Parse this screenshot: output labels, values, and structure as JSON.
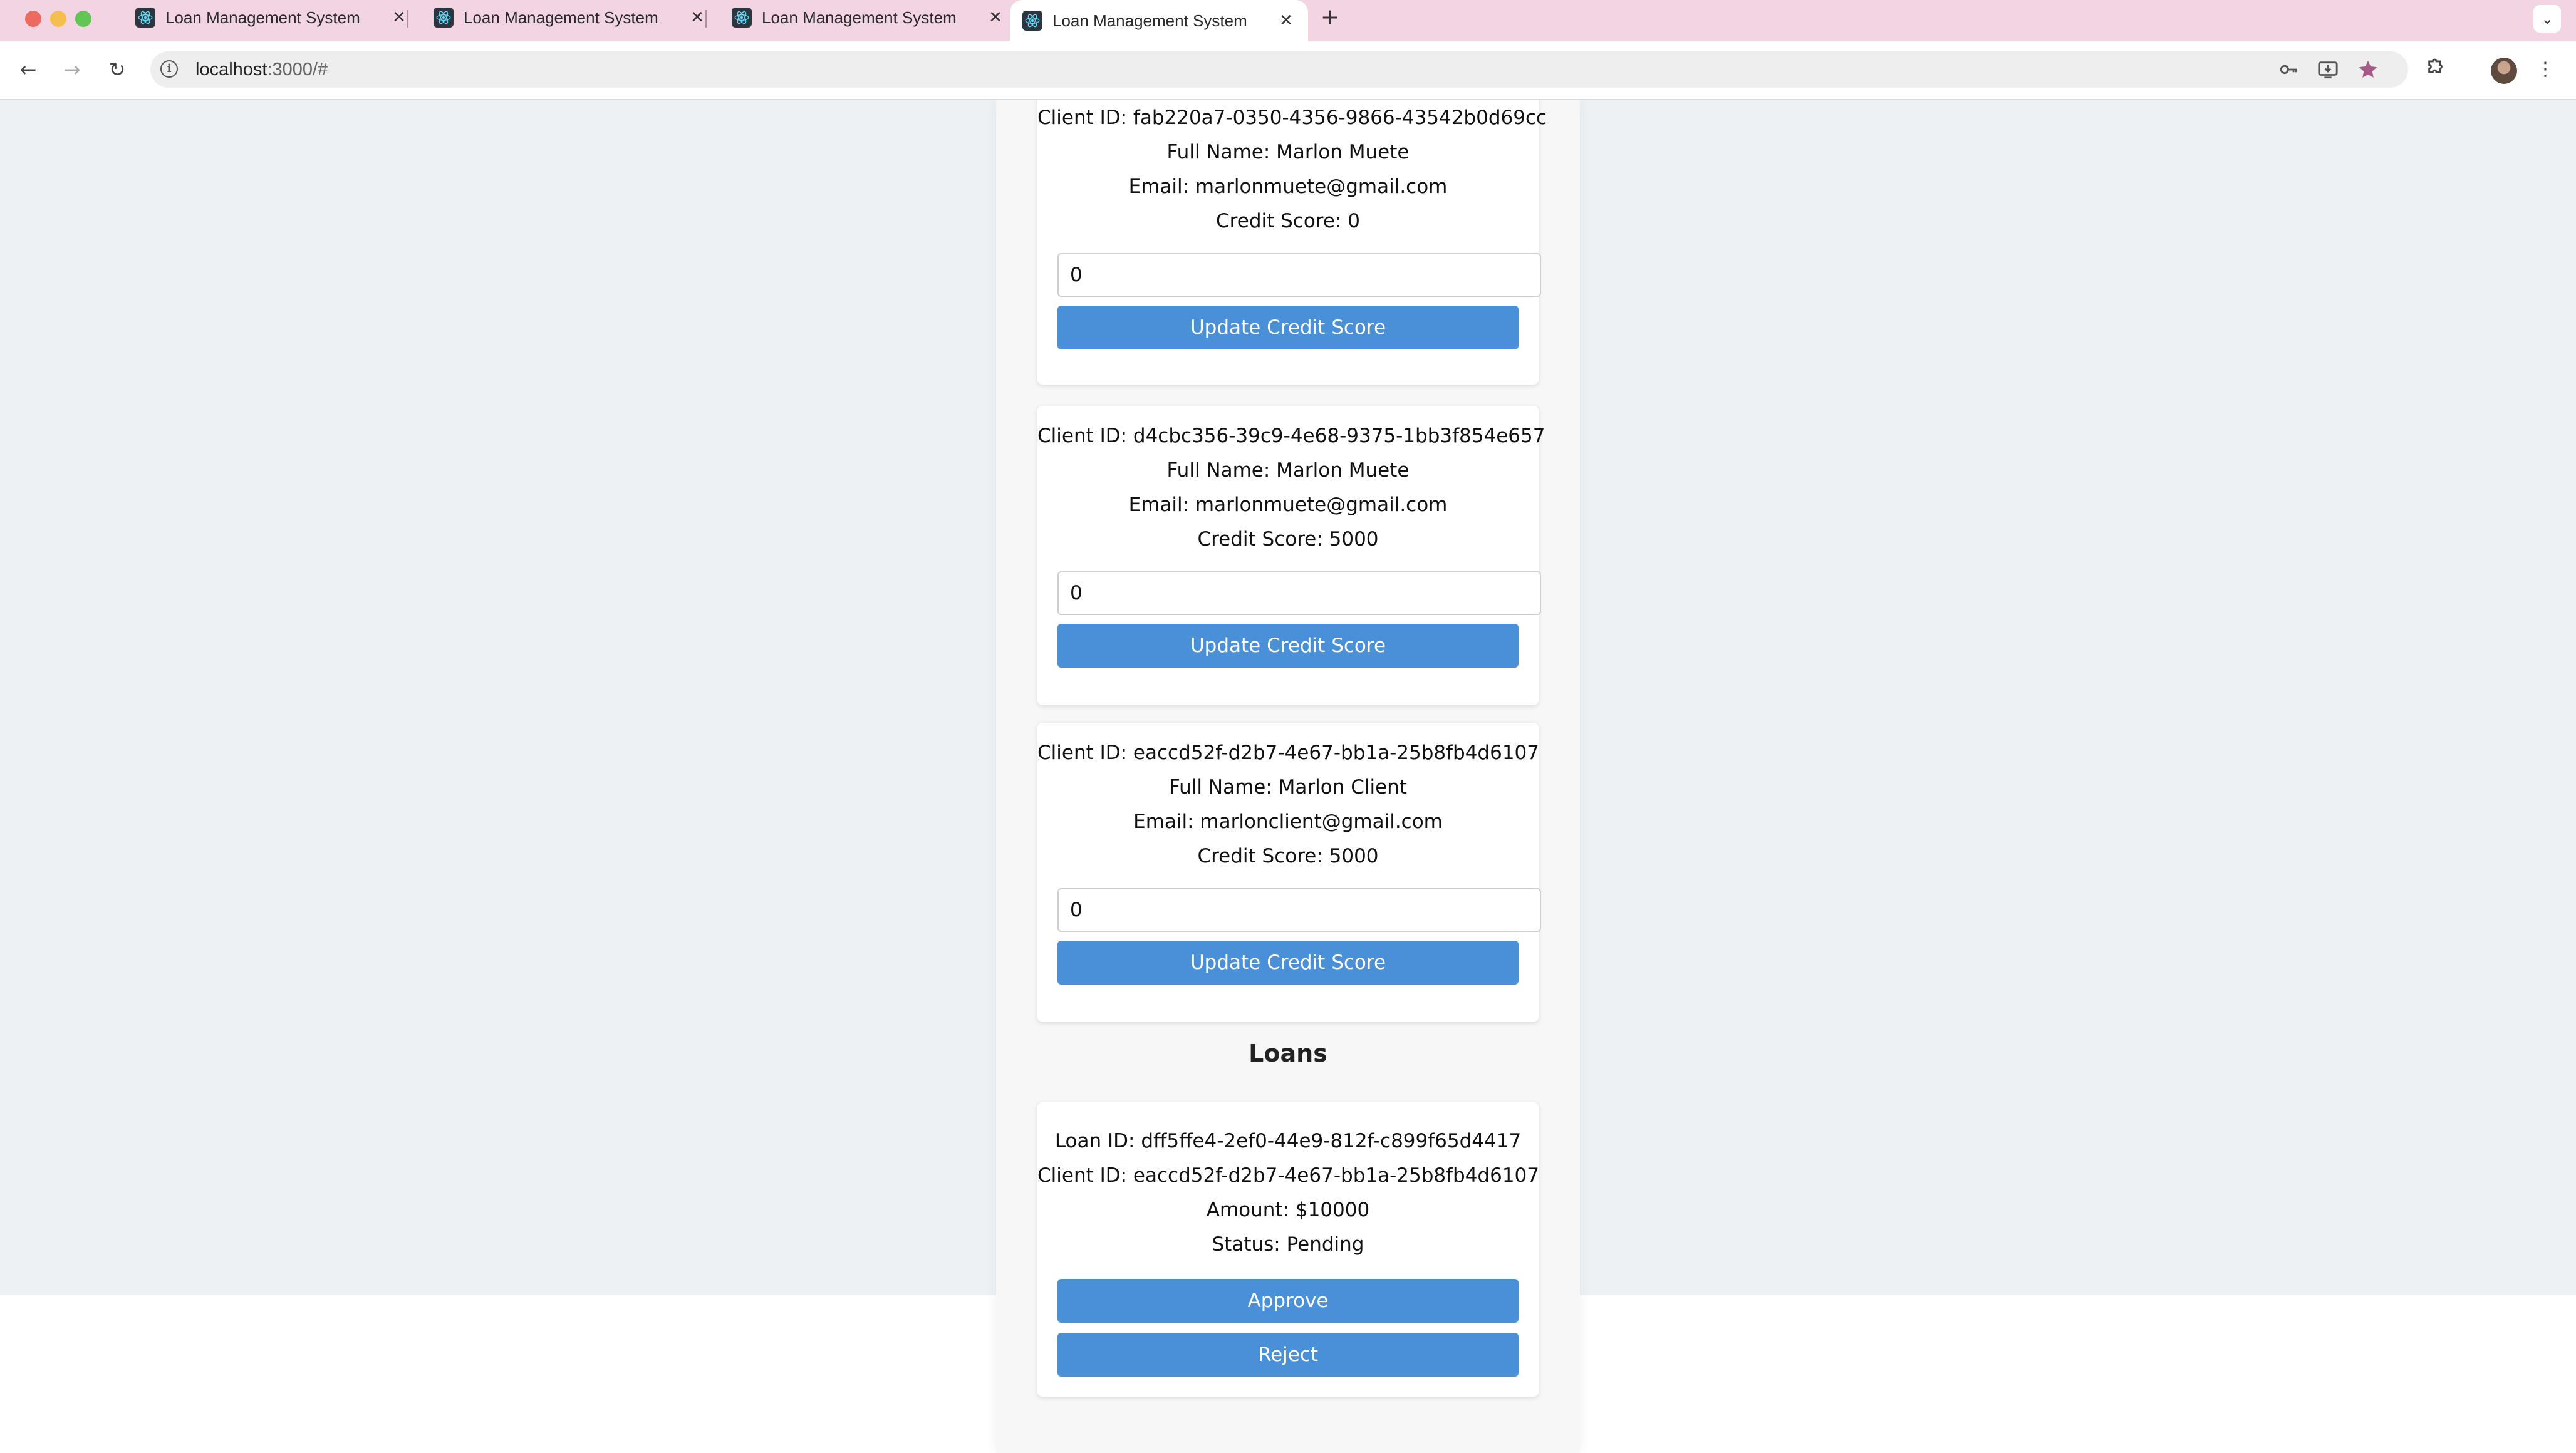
{
  "browser": {
    "tabs": [
      {
        "title": "Loan Management System",
        "close": "✕"
      },
      {
        "title": "Loan Management System",
        "close": "✕"
      },
      {
        "title": "Loan Management System",
        "close": "✕"
      },
      {
        "title": "Loan Management System",
        "close": "✕"
      }
    ],
    "active_tab": 3,
    "new_tab": "+",
    "url_host": "localhost",
    "url_rest": ":3000/#"
  },
  "clients": [
    {
      "id_label": "Client ID: fab220a7-0350-4356-9866-43542b0d69cc",
      "name_label": "Full Name: Marlon Muete",
      "email_label": "Email: marlonmuete@gmail.com",
      "score_label": "Credit Score: 0",
      "input_value": "0",
      "button": "Update Credit Score"
    },
    {
      "id_label": "Client ID: d4cbc356-39c9-4e68-9375-1bb3f854e657",
      "name_label": "Full Name: Marlon Muete",
      "email_label": "Email: marlonmuete@gmail.com",
      "score_label": "Credit Score: 5000",
      "input_value": "0",
      "button": "Update Credit Score"
    },
    {
      "id_label": "Client ID: eaccd52f-d2b7-4e67-bb1a-25b8fb4d6107",
      "name_label": "Full Name: Marlon Client",
      "email_label": "Email: marlonclient@gmail.com",
      "score_label": "Credit Score: 5000",
      "input_value": "0",
      "button": "Update Credit Score"
    }
  ],
  "loans_title": "Loans",
  "loans": [
    {
      "loan_label": "Loan ID: dff5ffe4-2ef0-44e9-812f-c899f65d4417",
      "client_label": "Client ID: eaccd52f-d2b7-4e67-bb1a-25b8fb4d6107",
      "amount_label": "Amount: $10000",
      "status_label": "Status: Pending",
      "approve": "Approve",
      "reject": "Reject"
    }
  ]
}
